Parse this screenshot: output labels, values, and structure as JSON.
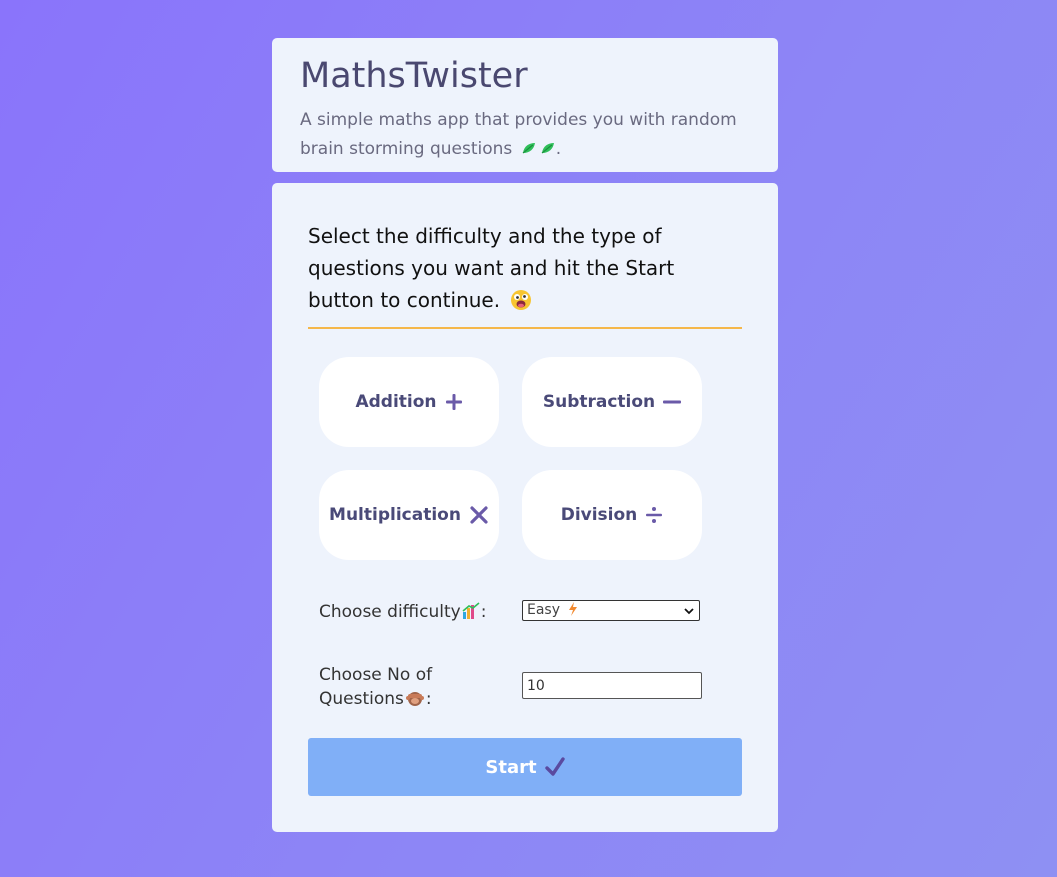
{
  "header": {
    "title": "MathsTwister",
    "description": "A simple maths app that provides you with random brain storming questions",
    "description_suffix": "."
  },
  "main": {
    "instructions": "Select the difficulty and the type of questions you want and hit the Start button to continue.",
    "operations": [
      {
        "label": "Addition",
        "icon": "plus-icon"
      },
      {
        "label": "Subtraction",
        "icon": "minus-icon"
      },
      {
        "label": "Multiplication",
        "icon": "times-icon"
      },
      {
        "label": "Division",
        "icon": "divide-icon"
      }
    ],
    "difficulty": {
      "label": "Choose difficulty",
      "label_suffix": ":",
      "selected": "Easy"
    },
    "question_count": {
      "label": "Choose No of Questions",
      "label_suffix": ":",
      "value": "10"
    },
    "start_label": "Start"
  },
  "colors": {
    "background": "#8a74fb",
    "card": "#eef3fc",
    "accent_divider": "#f5b74a",
    "button_text": "#4a4a78",
    "start_button": "#80aff7"
  }
}
